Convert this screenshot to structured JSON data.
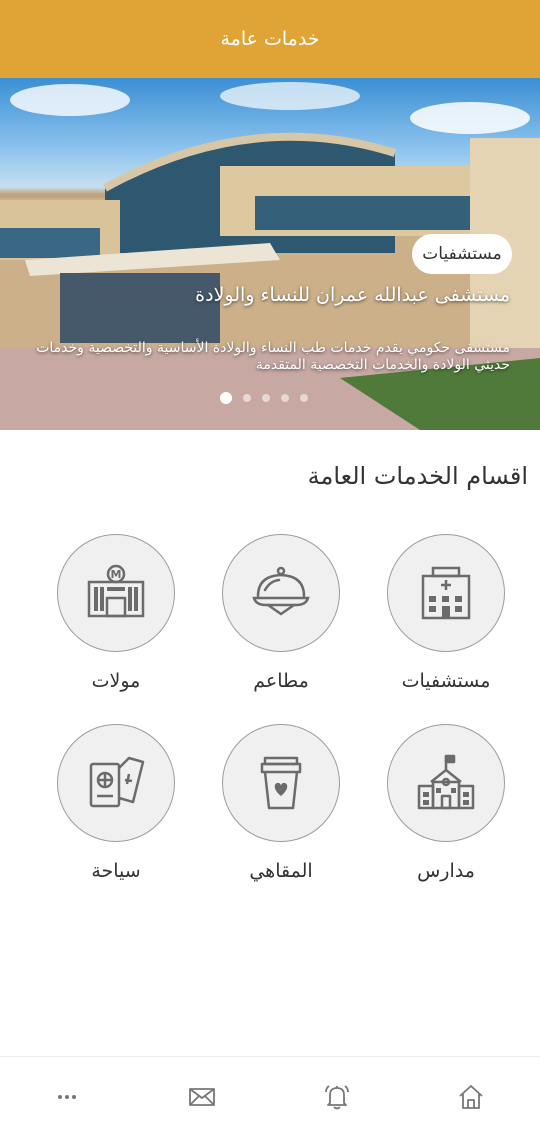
{
  "header": {
    "title": "خدمات عامة"
  },
  "hero": {
    "badge": "مستشفيات",
    "title": "مستشفى عبدالله عمران للنساء والولادة",
    "description": "مستشفى حكومي يقدم خدمات طب النساء والولادة الأساسية والتخصصية وخدمات حديثي الولادة والخدمات التخصصية المتقدمة",
    "slides_count": 5,
    "active_slide": 1
  },
  "section": {
    "title": "اقسام الخدمات العامة"
  },
  "categories": [
    {
      "label": "مستشفيات",
      "icon": "hospital-icon"
    },
    {
      "label": "مطاعم",
      "icon": "food-cloche-icon"
    },
    {
      "label": "مولات",
      "icon": "mall-icon"
    },
    {
      "label": "مدارس",
      "icon": "school-icon"
    },
    {
      "label": "المقاهي",
      "icon": "coffee-cup-icon"
    },
    {
      "label": "سياحة",
      "icon": "passport-icon"
    }
  ],
  "bottom_nav": [
    {
      "icon": "home-icon"
    },
    {
      "icon": "bell-icon"
    },
    {
      "icon": "mail-icon"
    },
    {
      "icon": "more-icon"
    }
  ]
}
